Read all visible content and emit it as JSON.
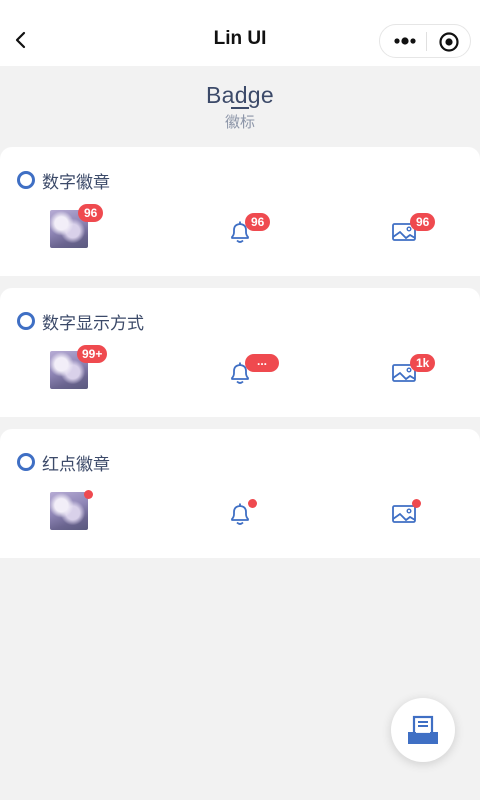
{
  "navbar": {
    "title": "Lin UI"
  },
  "header": {
    "title": "Badge",
    "subtitle": "徽标"
  },
  "sections": [
    {
      "title": "数字徽章",
      "badges": [
        "96",
        "96",
        "96"
      ]
    },
    {
      "title": "数字显示方式",
      "badges": [
        "99+",
        "...",
        "1k"
      ]
    },
    {
      "title": "红点徽章",
      "badges": []
    }
  ],
  "colors": {
    "accent": "#3f6fc4",
    "badge": "#ef4a4f",
    "text": "#3c4a69"
  },
  "icons": {
    "back": "chevron-left-icon",
    "more": "more-dots-icon",
    "close": "target-circle-icon",
    "bell": "bell-icon",
    "image": "image-icon",
    "fab": "document-box-icon"
  }
}
